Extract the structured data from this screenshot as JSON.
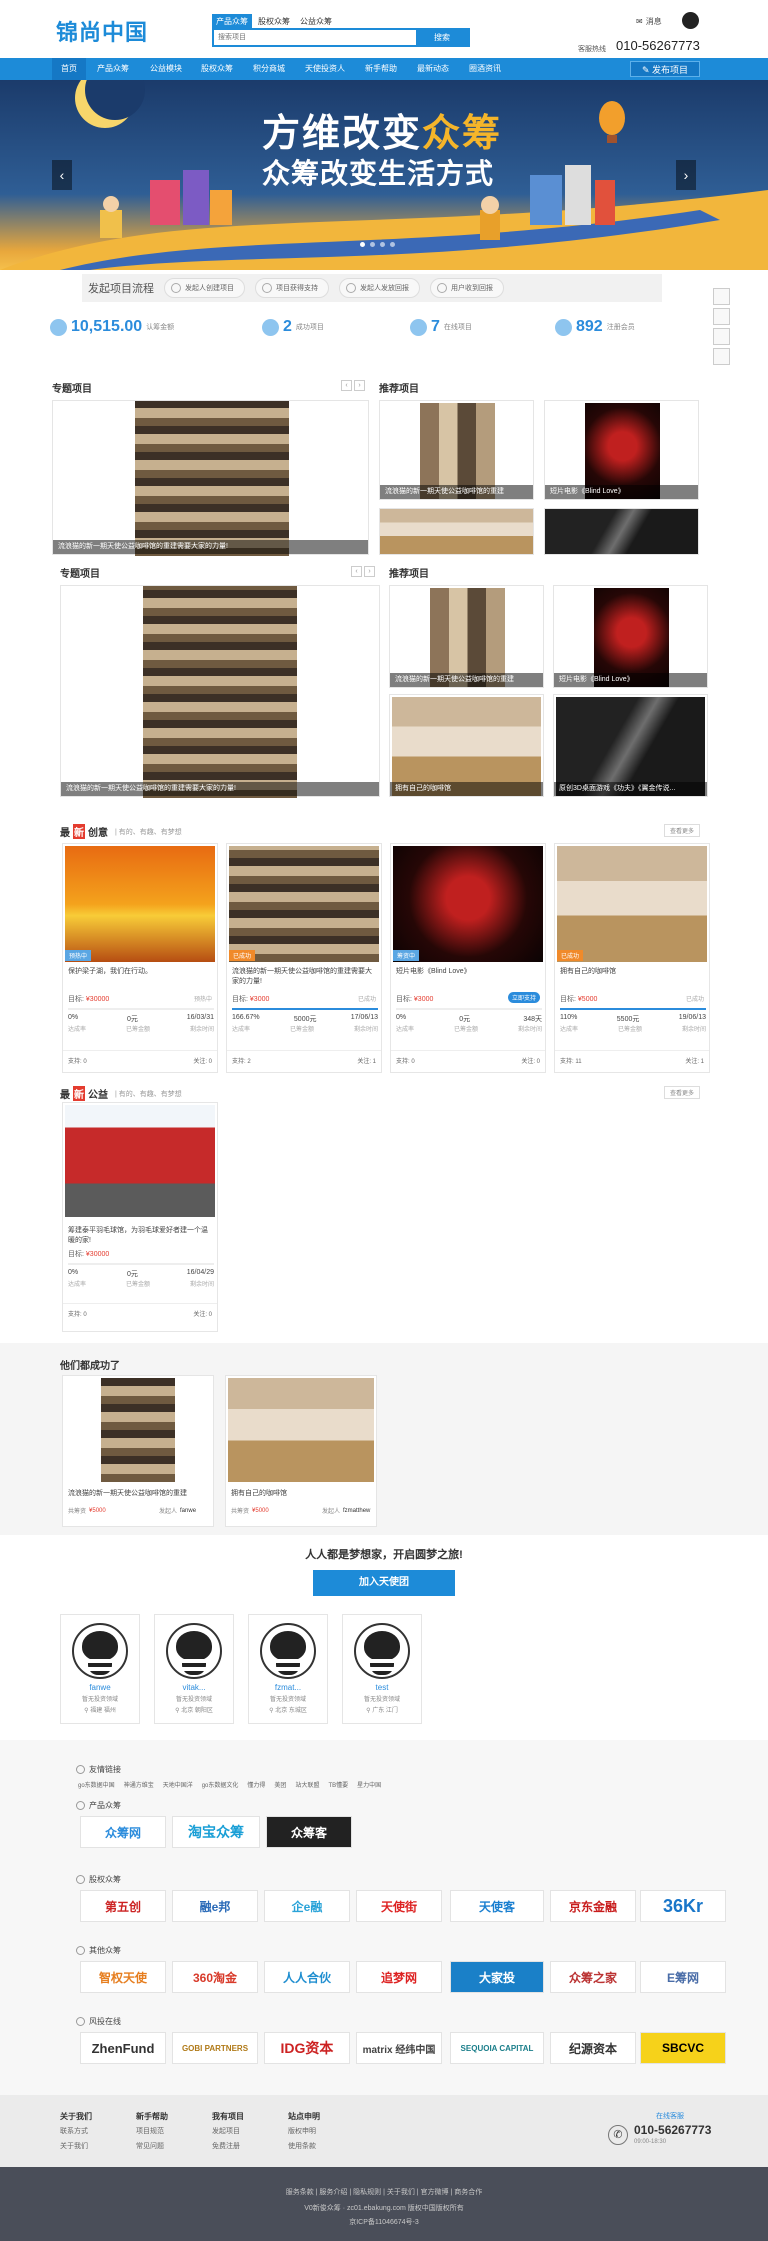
{
  "header": {
    "logo": "锦尚中国",
    "search_tabs": [
      "产品众筹",
      "股权众筹",
      "公益众筹"
    ],
    "search_placeholder": "搜索项目",
    "search_button": "搜索",
    "messages": "消息",
    "hotline_label": "客服热线",
    "hotline": "010-56267773"
  },
  "nav": {
    "items": [
      "首页",
      "产品众筹",
      "公益模块",
      "股权众筹",
      "积分商城",
      "天使投资人",
      "新手帮助",
      "最新动态",
      "圈酒资讯"
    ],
    "publish": "发布项目"
  },
  "banner": {
    "line1_prefix": "方维改变",
    "line1_highlight": "众筹",
    "line2": "众筹改变生活方式",
    "prev": "‹",
    "next": "›"
  },
  "process": {
    "title": "发起项目流程",
    "steps": [
      "发起人创建项目",
      "项目获得支持",
      "发起人发放回报",
      "用户收到回报"
    ]
  },
  "stats": [
    {
      "value": "10,515.00",
      "label": "认筹金额"
    },
    {
      "value": "2",
      "label": "成功项目"
    },
    {
      "value": "7",
      "label": "在线项目"
    },
    {
      "value": "892",
      "label": "注册会员"
    }
  ],
  "sections": {
    "special": "专题项目",
    "recommended": "推荐项目"
  },
  "captions": {
    "cats": "流浪猫的新一期天使公益咖啡馆的重建",
    "cats_long": "流浪猫的新一期天使公益咖啡馆的重建需要大家的力量!",
    "movie": "短片电影《Blind Love》",
    "coffee": "拥有自己的咖啡馆",
    "game": "原创3D桌面游戏《功夫》《翼金传说..."
  },
  "latest": {
    "title_pre": "最",
    "title_hl": "新",
    "title_post": "创意",
    "subtitle": "| 有的、有趣、有梦想",
    "more": "查看更多",
    "cards": [
      {
        "tag": "预热中",
        "tag_color": "#5aa6e3",
        "title": "保护梁子湖，我们在行动。",
        "goal": "¥30000",
        "status": "预热中",
        "percent": "0%",
        "raised": "0元",
        "time": "16/03/31",
        "pct_value": 0,
        "support": "支持: 0",
        "follow": "关注: 0"
      },
      {
        "tag": "已成功",
        "tag_color": "#f08a2a",
        "title": "流浪猫的新一期天使公益咖啡馆的重建需要大家的力量!",
        "goal": "¥3000",
        "status": "已成功",
        "percent": "166.67%",
        "raised": "5000元",
        "time": "17/06/13",
        "pct_value": 100,
        "support": "支持: 2",
        "follow": "关注: 1"
      },
      {
        "tag": "筹资中",
        "tag_color": "#5aa6e3",
        "title": "短片电影《Blind Love》",
        "goal": "¥3000",
        "status": "立即支持",
        "percent": "0%",
        "raised": "0元",
        "time": "348天",
        "pct_value": 0,
        "support": "支持: 0",
        "follow": "关注: 0"
      },
      {
        "tag": "已成功",
        "tag_color": "#f08a2a",
        "title": "拥有自己的咖啡馆",
        "goal": "¥5000",
        "status": "已成功",
        "percent": "110%",
        "raised": "5500元",
        "time": "19/06/13",
        "pct_value": 100,
        "support": "支持: 11",
        "follow": "关注: 1"
      }
    ],
    "labels": {
      "goal": "目标:",
      "reached": "达成率",
      "raised": "已筹金额",
      "remain": "剩余时间"
    }
  },
  "charity": {
    "title_pre": "最",
    "title_hl": "新",
    "title_post": "公益",
    "subtitle": "| 有的、有趣、有梦想",
    "more": "查看更多",
    "card": {
      "title": "筹建泰平羽毛球馆，为羽毛球爱好者建一个温暖的家!",
      "goal": "¥30000",
      "percent": "0%",
      "raised": "0元",
      "time": "16/04/29",
      "support": "支持: 0",
      "follow": "关注: 0"
    }
  },
  "success": {
    "title": "他们都成功了",
    "cards": [
      {
        "title": "流浪猫的新一期天使公益咖啡馆的重建",
        "amount_label": "共筹资",
        "amount": "¥5000",
        "owner_label": "发起人",
        "owner": "fanwe"
      },
      {
        "title": "拥有自己的咖啡馆",
        "amount_label": "共筹资",
        "amount": "¥5000",
        "owner_label": "发起人",
        "owner": "fzmatthew"
      }
    ]
  },
  "dream": {
    "slogan": "人人都是梦想家，开启圆梦之旅!",
    "join": "加入天使团"
  },
  "users": [
    {
      "name": "fanwe",
      "desc": "暂无投资领域",
      "loc": "福建 福州"
    },
    {
      "name": "vitak...",
      "desc": "暂无投资领域",
      "loc": "北京 朝阳区"
    },
    {
      "name": "fzmat...",
      "desc": "暂无投资领域",
      "loc": "北京 东城区"
    },
    {
      "name": "test",
      "desc": "暂无投资领域",
      "loc": "广东 江门"
    }
  ],
  "partners": {
    "friends_title": "友情链接",
    "friends": [
      "go东数据中国",
      "神通方维宝",
      "天地中国洋",
      "go东数据文化",
      "懂力得",
      "美团",
      "站大联盟",
      "TB懂要",
      "星力中国"
    ],
    "product_title": "产品众筹",
    "product_logos": [
      "众筹网",
      "淘宝众筹",
      "众筹客"
    ],
    "equity_title": "股权众筹",
    "equity_logos": [
      "第五创",
      "融e邦",
      "企e融",
      "天使街",
      "天使客",
      "京东金融",
      "36Kr"
    ],
    "other_title": "其他众筹",
    "other_logos": [
      "智权天使",
      "360淘金",
      "人人合伙",
      "追梦网",
      "大家投",
      "众筹之家",
      "E筹网"
    ],
    "vc_title": "风投在线",
    "vc_logos": [
      "ZhenFund",
      "GOBI PARTNERS",
      "IDG资本",
      "matrix 经纬中国",
      "SEQUOIA CAPITAL",
      "纪源资本",
      "SBCVC"
    ]
  },
  "footer": {
    "cols": [
      {
        "title": "关于我们",
        "items": [
          "联系方式",
          "关于我们"
        ]
      },
      {
        "title": "新手帮助",
        "items": [
          "项目规范",
          "常见问题"
        ]
      },
      {
        "title": "我有项目",
        "items": [
          "发起项目",
          "免费注册"
        ]
      },
      {
        "title": "站点申明",
        "items": [
          "版权申明",
          "使用条款"
        ]
      }
    ],
    "service_label": "在线客服",
    "service_phone": "010-56267773",
    "service_hours": "09:00-18:30",
    "links": "服务条款 | 服务介绍 | 隐私规则 | 关于我们 | 官方微博 | 商务合作",
    "copyright": "V0新俊众筹 · zc01.ebakung.com 版权中国版权所有",
    "icp": "京ICP备11046674号-3"
  }
}
